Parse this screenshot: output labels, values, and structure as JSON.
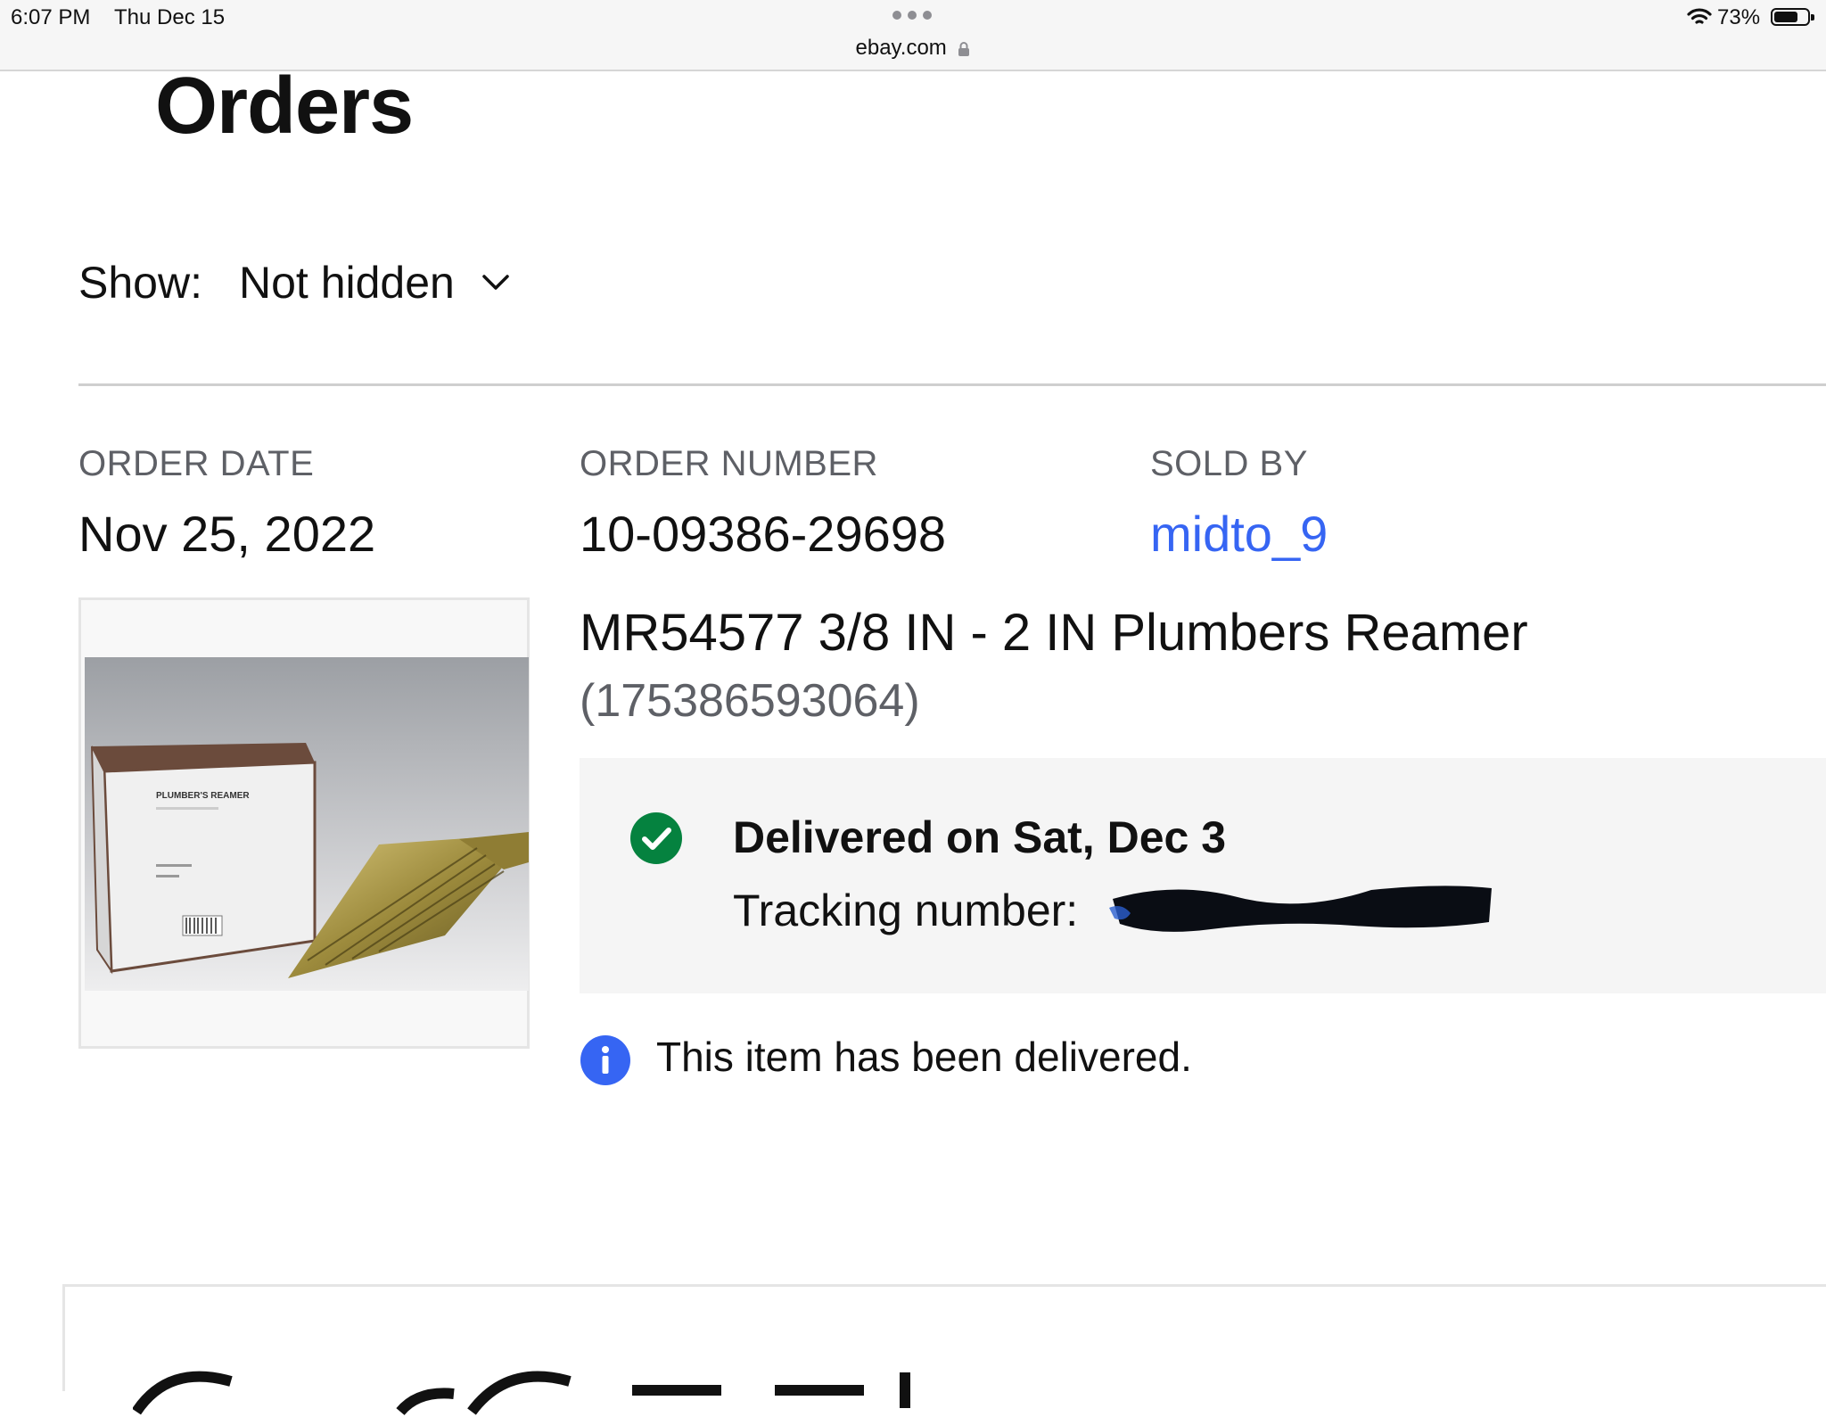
{
  "status_bar": {
    "time": "6:07 PM",
    "date": "Thu Dec 15",
    "url": "ebay.com",
    "battery": "73%",
    "battery_level": 0.73
  },
  "page": {
    "title": "Orders"
  },
  "filter": {
    "label": "Show:",
    "selected": "Not hidden"
  },
  "order": {
    "date_label": "ORDER DATE",
    "date": "Nov 25, 2022",
    "number_label": "ORDER NUMBER",
    "number": "10-09386-29698",
    "seller_label": "SOLD BY",
    "seller": "midto_9",
    "item_title": "MR54577 3/8 IN - 2 IN Plumbers Reamer",
    "item_id": "(175386593064)",
    "box_text": "PLUMBER'S REAMER"
  },
  "delivery": {
    "status": "Delivered on Sat, Dec 3",
    "tracking_label": "Tracking number:"
  },
  "info": {
    "message": "This item has been delivered."
  },
  "colors": {
    "link": "#3665f3",
    "success": "#05823f",
    "info": "#3665f3"
  },
  "icons": [
    "lock-icon",
    "wifi-icon",
    "battery-icon",
    "chevron-down-icon",
    "check-circle-icon",
    "info-icon"
  ]
}
